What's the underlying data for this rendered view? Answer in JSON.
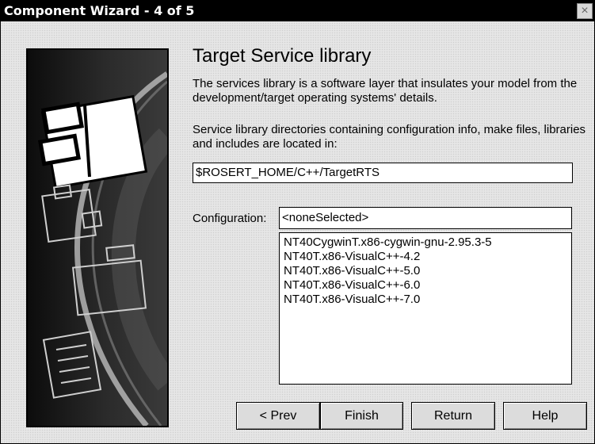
{
  "window": {
    "title": "Component Wizard -  4 of 5",
    "close_glyph": "×"
  },
  "page": {
    "heading": "Target Service library",
    "description_1": "The services library is a software layer that insulates your model from the development/target operating systems' details.",
    "description_2": "Service library directories containing configuration info, make files, libraries and includes are located in:"
  },
  "library_path": {
    "value": "$ROSERT_HOME/C++/TargetRTS"
  },
  "configuration": {
    "label": "Configuration:",
    "selected": "<noneSelected>",
    "options": [
      "NT40CygwinT.x86-cygwin-gnu-2.95.3-5",
      "NT40T.x86-VisualC++-4.2",
      "NT40T.x86-VisualC++-5.0",
      "NT40T.x86-VisualC++-6.0",
      "NT40T.x86-VisualC++-7.0"
    ]
  },
  "buttons": {
    "prev": "< Prev",
    "finish": "Finish",
    "return": "Return",
    "help": "Help"
  }
}
